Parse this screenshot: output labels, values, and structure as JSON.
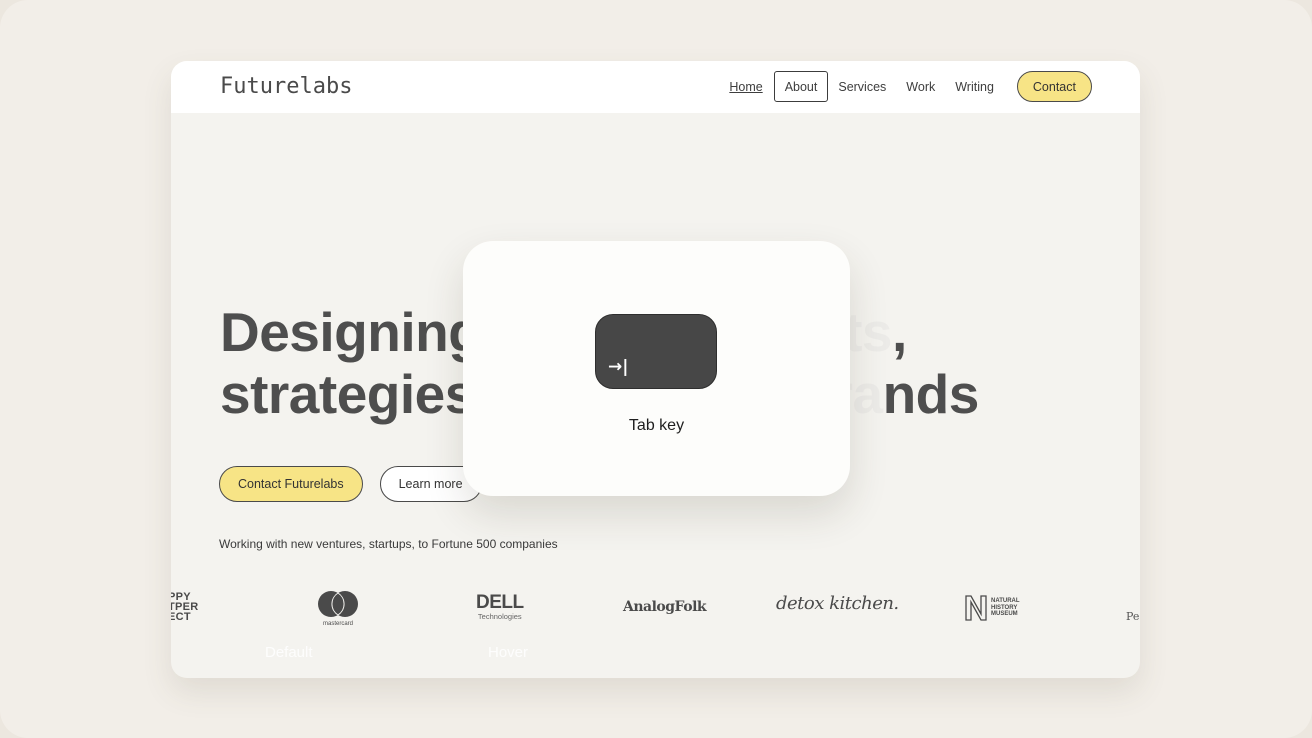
{
  "site": {
    "logo": "Futurelabs",
    "nav": {
      "items": [
        {
          "label": "Home",
          "state": "current"
        },
        {
          "label": "About",
          "state": "focused"
        },
        {
          "label": "Services",
          "state": "default"
        },
        {
          "label": "Work",
          "state": "default"
        },
        {
          "label": "Writing",
          "state": "default"
        }
      ],
      "contact_label": "Contact"
    },
    "hero": {
      "line1_visible": "Designing",
      "line1_faded": " better products",
      "line1_end": ",",
      "line2_visible": "strategies",
      "line2_faded": ", ventures & bra",
      "line2_end": "nds"
    },
    "cta": {
      "primary_label": "Contact Futurelabs",
      "secondary_label": "Learn more"
    },
    "clients": {
      "caption": "Working with new ventures, startups, to Fortune 500 companies",
      "logos": [
        {
          "name": "Happy Paper Project",
          "text": "PPY\nTPER\nECT"
        },
        {
          "name": "Mastercard",
          "text": "mastercard"
        },
        {
          "name": "Dell Technologies",
          "text": "DELL",
          "sub": "Technologies"
        },
        {
          "name": "AnalogFolk",
          "text": "AnalogFolk"
        },
        {
          "name": "Detox Kitchen",
          "text": "detox kitchen."
        },
        {
          "name": "Natural History Museum",
          "text": "NATURAL\nHISTORY\nMUSEUM"
        },
        {
          "name": "Partial logo",
          "text": "Pe"
        }
      ]
    },
    "state_labels": [
      "Default",
      "Hover"
    ]
  },
  "overlay": {
    "key_glyph": "→|",
    "key_label": "Tab key"
  },
  "colors": {
    "accent_yellow": "#f7e486",
    "text_dark": "#4e4e4e",
    "key_cap": "#474747",
    "background": "#f2eee8"
  }
}
